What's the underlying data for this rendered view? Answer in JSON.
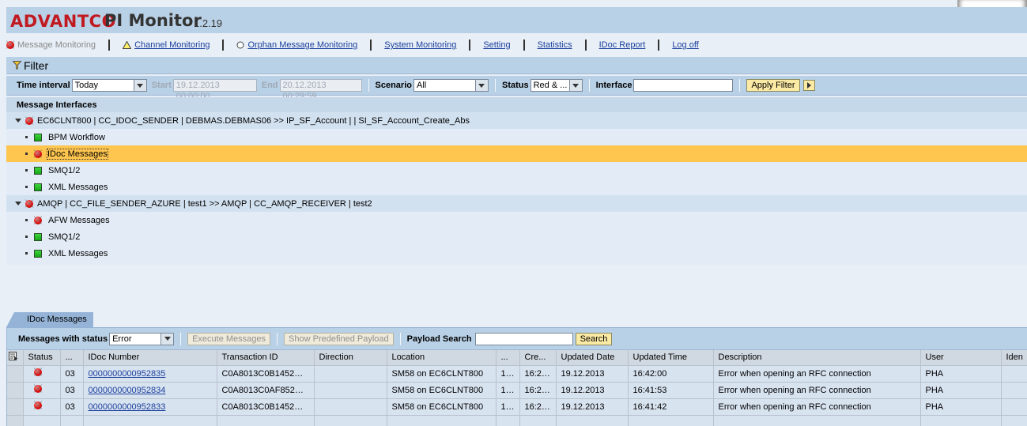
{
  "header": {
    "logo": "ADVANTCO",
    "app_name": "PI Monitor",
    "version": "1.2.19"
  },
  "nav": {
    "items": [
      {
        "label": "Message Monitoring",
        "icon": "red-led-icon",
        "current": true
      },
      {
        "label": "Channel Monitoring",
        "icon": "warning-triangle-icon"
      },
      {
        "label": "Orphan Message Monitoring",
        "icon": "circle-icon"
      },
      {
        "label": "System Monitoring"
      },
      {
        "label": "Setting"
      },
      {
        "label": "Statistics"
      },
      {
        "label": "IDoc Report"
      },
      {
        "label": "Log off"
      }
    ]
  },
  "filter": {
    "title": "Filter",
    "time_interval_label": "Time interval",
    "time_interval_value": "Today",
    "start_label": "Start",
    "start_value": "19.12.2013 00:00:00",
    "end_label": "End",
    "end_value": "20.12.2013 00:29:59",
    "scenario_label": "Scenario",
    "scenario_value": "All",
    "status_label": "Status",
    "status_value": "Red & ...",
    "interface_label": "Interface",
    "interface_value": "",
    "apply_label": "Apply Filter"
  },
  "interfaces": {
    "title": "Message Interfaces",
    "groups": [
      {
        "label": "EC6CLNT800 | CC_IDOC_SENDER | DEBMAS.DEBMAS06 >> IP_SF_Account | | SI_SF_Account_Create_Abs",
        "status": "red",
        "children": [
          {
            "label": "BPM Workflow",
            "status": "green"
          },
          {
            "label": "IDoc Messages",
            "status": "red",
            "selected": true
          },
          {
            "label": "SMQ1/2",
            "status": "green"
          },
          {
            "label": "XML Messages",
            "status": "green"
          }
        ]
      },
      {
        "label": "AMQP | CC_FILE_SENDER_AZURE | test1 >> AMQP | CC_AMQP_RECEIVER | test2",
        "status": "red",
        "children": [
          {
            "label": "AFW Messages",
            "status": "red"
          },
          {
            "label": "SMQ1/2",
            "status": "green"
          },
          {
            "label": "XML Messages",
            "status": "green"
          }
        ]
      }
    ]
  },
  "detail": {
    "tab_label": "IDoc Messages",
    "status_label": "Messages with status",
    "status_value": "Error",
    "execute_label": "Execute Messages",
    "predefined_label": "Show Predefined Payload",
    "payload_search_label": "Payload Search",
    "payload_search_value": "",
    "search_label": "Search",
    "columns": [
      "Status",
      "...",
      "IDoc Number",
      "Transaction ID",
      "Direction",
      "Location",
      "...",
      "Cre...",
      "Updated Date",
      "Updated Time",
      "Description",
      "User",
      "Iden"
    ],
    "rows": [
      {
        "status": "red",
        "code": "03",
        "idoc": "0000000000952835",
        "tid": "C0A8013C0B1452B…",
        "direction": "",
        "location": "SM58 on EC6CLNT800",
        "c1": "1…",
        "created": "16:2…",
        "date": "19.12.2013",
        "time": "16:42:00",
        "desc": "Error when opening an RFC connection",
        "user": "PHA",
        "ident": ""
      },
      {
        "status": "red",
        "code": "03",
        "idoc": "0000000000952834",
        "tid": "C0A8013C0AF852B…",
        "direction": "",
        "location": "SM58 on EC6CLNT800",
        "c1": "1…",
        "created": "16:2…",
        "date": "19.12.2013",
        "time": "16:41:53",
        "desc": "Error when opening an RFC connection",
        "user": "PHA",
        "ident": ""
      },
      {
        "status": "red",
        "code": "03",
        "idoc": "0000000000952833",
        "tid": "C0A8013C0B1452B…",
        "direction": "",
        "location": "SM58 on EC6CLNT800",
        "c1": "1…",
        "created": "16:2…",
        "date": "19.12.2013",
        "time": "16:41:42",
        "desc": "Error when opening an RFC connection",
        "user": "PHA",
        "ident": ""
      }
    ]
  }
}
